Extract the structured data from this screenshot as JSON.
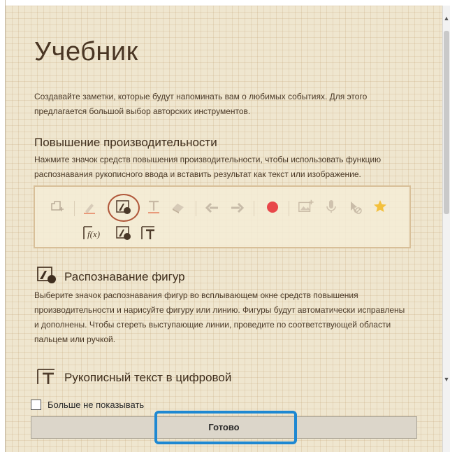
{
  "title": "Учебник",
  "intro": "Создавайте заметки, которые будут напоминать вам о любимых событиях. Для этого предлагается большой выбор авторских инструментов.",
  "section_productivity": {
    "heading": "Повышение производительности",
    "text": "Нажмите значок средств повышения производительности, чтобы использовать функцию распознавания рукописного ввода и вставить результат как текст или изображение."
  },
  "toolbar": {
    "row1_icons": [
      "add-page-icon",
      "pen-icon",
      "shape-recognition-icon",
      "text-icon",
      "eraser-icon",
      "undo-icon",
      "redo-icon",
      "record-icon",
      "insert-image-icon",
      "microphone-icon",
      "pointer-off-icon",
      "favorite-icon"
    ],
    "row2_icons": [
      "formula-icon",
      "shape-recognition-icon",
      "handwriting-to-text-icon"
    ],
    "formula_label": "f(x)"
  },
  "section_shapes": {
    "heading": "Распознавание фигур",
    "text": "Выберите значок распознавания фигур во всплывающем окне средств повышения производительности и нарисуйте фигуру или линию. Фигуры будут автоматически исправлены и дополнены. Чтобы стереть выступающие линии, проведите по соответствующей области пальцем или ручкой."
  },
  "section_handwriting": {
    "heading": "Рукописный текст в цифровой"
  },
  "footer": {
    "dont_show_label": "Больше не показывать",
    "done_label": "Готово"
  },
  "colors": {
    "paper": "#efe6cf",
    "highlight_circle": "#b0573a",
    "highlight_button": "#1e88d2",
    "record_red": "#e8474a",
    "star_yellow": "#f3c03c"
  }
}
